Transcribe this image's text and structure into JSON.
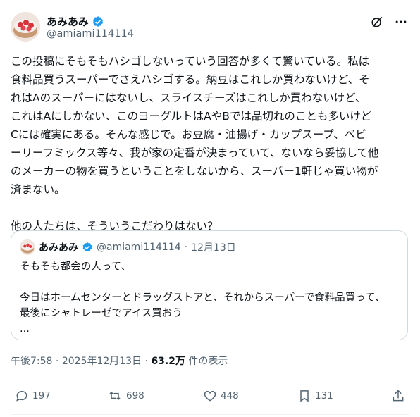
{
  "author": {
    "display_name": "あみあみ",
    "handle": "@amiami114114"
  },
  "tweet": {
    "text": "この投稿にそもそもハシゴしないっていう回答が多くて驚いている。私は\n食料品買うスーパーでさえハシゴする。納豆はこれしか買わないけど、そ\nれはAのスーパーにはないし、スライスチーズはこれしか買わないけど、\nこれはAにしかない、このヨーグルトはAやBでは品切れのことも多いけど\nCには確実にある。そんな感じで。お豆腐・油揚げ・カップスープ、ベビ\nーリーフミックス等々、我が家の定番が決まっていて、ないなら妥協して他\nのメーカーの物を買うということをしないから、スーパー1軒じゃ買い物が\n済まない。\n\n他の人たちは、そういうこだわりはない？"
  },
  "quote": {
    "display_name": "あみあみ",
    "handle": "@amiami114114",
    "separator": "·",
    "date": "12月13日",
    "text": "そもそも都会の人って、\n\n今日はホームセンターとドラッグストアと、それからスーパーで食料品買って、\n最後にシャトレーゼでアイス買おう\n..."
  },
  "meta": {
    "time": "午後7:58",
    "dot": "·",
    "date": "2025年12月13日",
    "dot2": "·",
    "views": "63.2万",
    "views_label": "件の表示"
  },
  "actions": {
    "replies": "197",
    "retweets": "698",
    "likes": "448",
    "bookmarks": "131"
  },
  "colors": {
    "verified": "#1d9bf0",
    "muted": "#536471"
  }
}
